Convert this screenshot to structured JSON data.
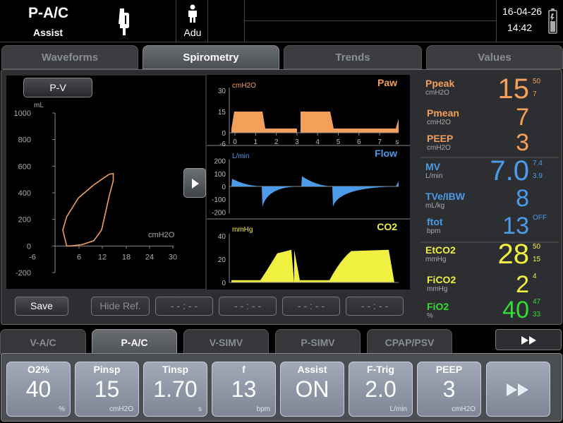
{
  "header": {
    "mode": "P-A/C",
    "mode_sub": "Assist",
    "patient_type": "Adu",
    "date": "16-04-26",
    "time": "14:42",
    "icons": {
      "vent": "ventilator-icon",
      "patient": "adult-patient-icon",
      "battery": "battery-icon"
    }
  },
  "tabs": [
    {
      "label": "Waveforms",
      "active": false
    },
    {
      "label": "Spirometry",
      "active": true
    },
    {
      "label": "Trends",
      "active": false
    },
    {
      "label": "Values",
      "active": false
    }
  ],
  "loop": {
    "selector_label": "P-V",
    "y_unit": "mL",
    "x_unit": "cmH2O",
    "y_ticks": [
      "1000",
      "800",
      "600",
      "400",
      "200",
      "0",
      "-200"
    ],
    "x_ticks": [
      "-6",
      "6",
      "12",
      "18",
      "24",
      "30"
    ],
    "loop_color": "#f0a060",
    "loop_points": [
      [
        3,
        0
      ],
      [
        2,
        120
      ],
      [
        3,
        220
      ],
      [
        6,
        360
      ],
      [
        10,
        460
      ],
      [
        14,
        540
      ],
      [
        15,
        545
      ],
      [
        15,
        490
      ],
      [
        14,
        380
      ],
      [
        13,
        250
      ],
      [
        12,
        120
      ],
      [
        10,
        40
      ],
      [
        7,
        10
      ],
      [
        4,
        0
      ],
      [
        3,
        0
      ]
    ]
  },
  "panel_buttons": {
    "save": "Save",
    "hide_ref": "Hide Ref.",
    "slots": [
      "- - : - -",
      "- - : - -",
      "- - : - -",
      "- - : - -"
    ]
  },
  "waves": {
    "paw": {
      "name": "Paw",
      "unit": "cmH2O",
      "ticks": [
        "30",
        "15",
        "0",
        "-6"
      ],
      "color": "#f5a05a"
    },
    "flow": {
      "name": "Flow",
      "unit": "L/min",
      "ticks": [
        "200",
        "100",
        "0",
        "-100",
        "-200"
      ],
      "color": "#4b9be8"
    },
    "co2": {
      "name": "CO2",
      "unit": "mmHg",
      "ticks": [
        "40",
        "20",
        "0"
      ],
      "color": "#f0f040"
    },
    "time_ticks": [
      "0",
      "1",
      "2",
      "3",
      "4",
      "5",
      "6",
      "7",
      "s"
    ]
  },
  "parameters": [
    {
      "name": "Ppeak",
      "unit": "cmH2O",
      "value": "15",
      "hi": "50",
      "lo": "7",
      "color": "#f5a05a"
    },
    {
      "name": "Pmean",
      "unit": "cmH2O",
      "value": "7",
      "hi": "",
      "lo": "",
      "color": "#f5a05a"
    },
    {
      "name": "PEEP",
      "unit": "cmH2O",
      "value": "3",
      "hi": "",
      "lo": "",
      "color": "#f5a05a"
    },
    {
      "name": "MV",
      "unit": "L/min",
      "value": "7.0",
      "hi": "7.4",
      "lo": "3.9",
      "color": "#4b9be8"
    },
    {
      "name": "TVe/IBW",
      "unit": "mL/kg",
      "value": "8",
      "hi": "",
      "lo": "",
      "color": "#4b9be8"
    },
    {
      "name": "ftot",
      "unit": "bpm",
      "value": "13",
      "hi": "OFF",
      "lo": "",
      "color": "#4b9be8"
    },
    {
      "name": "EtCO2",
      "unit": "mmHg",
      "value": "28",
      "hi": "50",
      "lo": "15",
      "color": "#f0f040"
    },
    {
      "name": "FiCO2",
      "unit": "mmHg",
      "value": "2",
      "hi": "4",
      "lo": "",
      "color": "#f0f040"
    },
    {
      "name": "FiO2",
      "unit": "%",
      "value": "40",
      "hi": "47",
      "lo": "33",
      "color": "#33dd33"
    }
  ],
  "mode_tabs": [
    {
      "label": "V-A/C",
      "active": false
    },
    {
      "label": "P-A/C",
      "active": true
    },
    {
      "label": "V-SIMV",
      "active": false
    },
    {
      "label": "P-SIMV",
      "active": false
    },
    {
      "label": "CPAP/PSV",
      "active": false
    }
  ],
  "settings": [
    {
      "name": "O2%",
      "value": "40",
      "unit": "%"
    },
    {
      "name": "Pinsp",
      "value": "15",
      "unit": "cmH2O"
    },
    {
      "name": "Tinsp",
      "value": "1.70",
      "unit": "s"
    },
    {
      "name": "f",
      "value": "13",
      "unit": "bpm"
    },
    {
      "name": "Assist",
      "value": "ON",
      "unit": ""
    },
    {
      "name": "F-Trig",
      "value": "2.0",
      "unit": "L/min"
    },
    {
      "name": "PEEP",
      "value": "3",
      "unit": "cmH2O"
    }
  ]
}
